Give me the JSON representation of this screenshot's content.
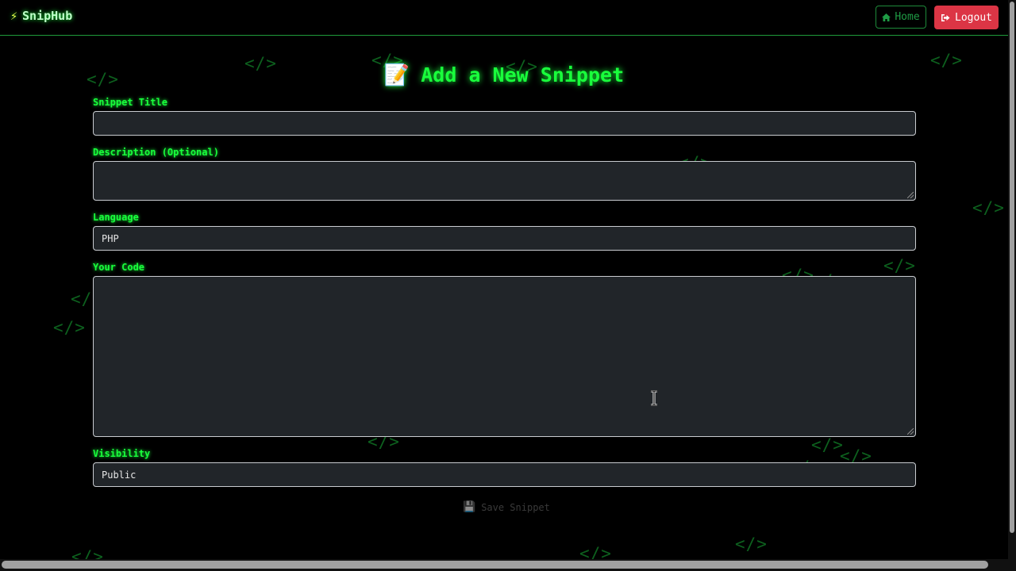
{
  "nav": {
    "brand_icon": "⚡",
    "brand": "SnipHub",
    "home_label": "Home",
    "logout_label": "Logout"
  },
  "page": {
    "title_icon": "📝",
    "title": "Add a New Snippet"
  },
  "form": {
    "title_label": "Snippet Title",
    "title_value": "",
    "description_label": "Description (Optional)",
    "description_value": "",
    "language_label": "Language",
    "language_value": "PHP",
    "code_label": "Your Code",
    "code_value": "",
    "visibility_label": "Visibility",
    "visibility_value": "Public",
    "save_icon": "💾",
    "save_label": "Save Snippet"
  },
  "background": {
    "tag_glyph": "</>"
  },
  "colors": {
    "accent": "#19ff3c",
    "background": "#000000",
    "field_bg": "#212529",
    "logout": "#dc3545",
    "bg_tag": "#0f6b22"
  }
}
